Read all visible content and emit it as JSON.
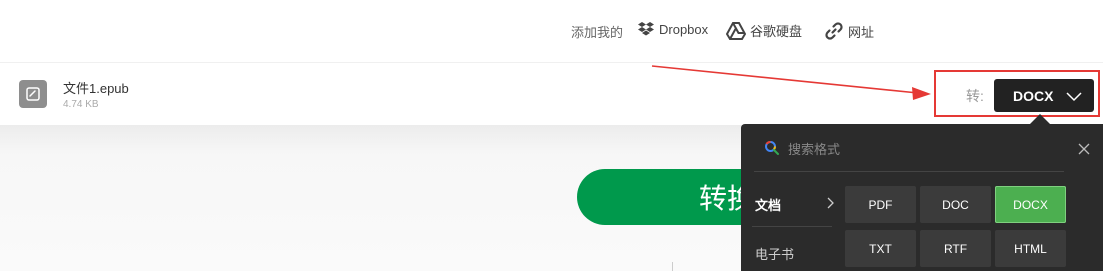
{
  "topbar": {
    "add_label": "添加我的",
    "sources": [
      {
        "label": "Dropbox",
        "icon": "dropbox-icon"
      },
      {
        "label": "谷歌硬盘",
        "icon": "google-drive-icon"
      },
      {
        "label": "网址",
        "icon": "link-icon"
      }
    ]
  },
  "file": {
    "name": "文件1.epub",
    "size": "4.74 KB",
    "icon": "ebook-file-icon"
  },
  "convert": {
    "to_label": "转:",
    "selected_format": "DOCX",
    "button_label": "转换"
  },
  "dropdown": {
    "search_placeholder": "搜索格式",
    "categories": [
      {
        "label": "文档",
        "active": true
      },
      {
        "label": "电子书",
        "active": false
      }
    ],
    "formats": [
      {
        "label": "PDF",
        "selected": false
      },
      {
        "label": "DOC",
        "selected": false
      },
      {
        "label": "DOCX",
        "selected": true
      },
      {
        "label": "TXT",
        "selected": false
      },
      {
        "label": "RTF",
        "selected": false
      },
      {
        "label": "HTML",
        "selected": false
      }
    ]
  },
  "colors": {
    "annotation_red": "#e53935",
    "convert_green": "#00994c",
    "selected_green": "#4caf50",
    "dropdown_bg": "#2b2b2b"
  }
}
